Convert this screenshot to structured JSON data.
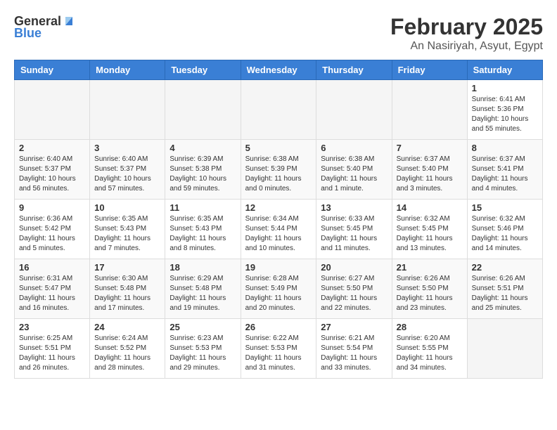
{
  "header": {
    "logo_general": "General",
    "logo_blue": "Blue",
    "month": "February 2025",
    "location": "An Nasiriyah, Asyut, Egypt"
  },
  "days_of_week": [
    "Sunday",
    "Monday",
    "Tuesday",
    "Wednesday",
    "Thursday",
    "Friday",
    "Saturday"
  ],
  "weeks": [
    [
      {
        "day": "",
        "info": ""
      },
      {
        "day": "",
        "info": ""
      },
      {
        "day": "",
        "info": ""
      },
      {
        "day": "",
        "info": ""
      },
      {
        "day": "",
        "info": ""
      },
      {
        "day": "",
        "info": ""
      },
      {
        "day": "1",
        "info": "Sunrise: 6:41 AM\nSunset: 5:36 PM\nDaylight: 10 hours and 55 minutes."
      }
    ],
    [
      {
        "day": "2",
        "info": "Sunrise: 6:40 AM\nSunset: 5:37 PM\nDaylight: 10 hours and 56 minutes."
      },
      {
        "day": "3",
        "info": "Sunrise: 6:40 AM\nSunset: 5:37 PM\nDaylight: 10 hours and 57 minutes."
      },
      {
        "day": "4",
        "info": "Sunrise: 6:39 AM\nSunset: 5:38 PM\nDaylight: 10 hours and 59 minutes."
      },
      {
        "day": "5",
        "info": "Sunrise: 6:38 AM\nSunset: 5:39 PM\nDaylight: 11 hours and 0 minutes."
      },
      {
        "day": "6",
        "info": "Sunrise: 6:38 AM\nSunset: 5:40 PM\nDaylight: 11 hours and 1 minute."
      },
      {
        "day": "7",
        "info": "Sunrise: 6:37 AM\nSunset: 5:40 PM\nDaylight: 11 hours and 3 minutes."
      },
      {
        "day": "8",
        "info": "Sunrise: 6:37 AM\nSunset: 5:41 PM\nDaylight: 11 hours and 4 minutes."
      }
    ],
    [
      {
        "day": "9",
        "info": "Sunrise: 6:36 AM\nSunset: 5:42 PM\nDaylight: 11 hours and 5 minutes."
      },
      {
        "day": "10",
        "info": "Sunrise: 6:35 AM\nSunset: 5:43 PM\nDaylight: 11 hours and 7 minutes."
      },
      {
        "day": "11",
        "info": "Sunrise: 6:35 AM\nSunset: 5:43 PM\nDaylight: 11 hours and 8 minutes."
      },
      {
        "day": "12",
        "info": "Sunrise: 6:34 AM\nSunset: 5:44 PM\nDaylight: 11 hours and 10 minutes."
      },
      {
        "day": "13",
        "info": "Sunrise: 6:33 AM\nSunset: 5:45 PM\nDaylight: 11 hours and 11 minutes."
      },
      {
        "day": "14",
        "info": "Sunrise: 6:32 AM\nSunset: 5:45 PM\nDaylight: 11 hours and 13 minutes."
      },
      {
        "day": "15",
        "info": "Sunrise: 6:32 AM\nSunset: 5:46 PM\nDaylight: 11 hours and 14 minutes."
      }
    ],
    [
      {
        "day": "16",
        "info": "Sunrise: 6:31 AM\nSunset: 5:47 PM\nDaylight: 11 hours and 16 minutes."
      },
      {
        "day": "17",
        "info": "Sunrise: 6:30 AM\nSunset: 5:48 PM\nDaylight: 11 hours and 17 minutes."
      },
      {
        "day": "18",
        "info": "Sunrise: 6:29 AM\nSunset: 5:48 PM\nDaylight: 11 hours and 19 minutes."
      },
      {
        "day": "19",
        "info": "Sunrise: 6:28 AM\nSunset: 5:49 PM\nDaylight: 11 hours and 20 minutes."
      },
      {
        "day": "20",
        "info": "Sunrise: 6:27 AM\nSunset: 5:50 PM\nDaylight: 11 hours and 22 minutes."
      },
      {
        "day": "21",
        "info": "Sunrise: 6:26 AM\nSunset: 5:50 PM\nDaylight: 11 hours and 23 minutes."
      },
      {
        "day": "22",
        "info": "Sunrise: 6:26 AM\nSunset: 5:51 PM\nDaylight: 11 hours and 25 minutes."
      }
    ],
    [
      {
        "day": "23",
        "info": "Sunrise: 6:25 AM\nSunset: 5:51 PM\nDaylight: 11 hours and 26 minutes."
      },
      {
        "day": "24",
        "info": "Sunrise: 6:24 AM\nSunset: 5:52 PM\nDaylight: 11 hours and 28 minutes."
      },
      {
        "day": "25",
        "info": "Sunrise: 6:23 AM\nSunset: 5:53 PM\nDaylight: 11 hours and 29 minutes."
      },
      {
        "day": "26",
        "info": "Sunrise: 6:22 AM\nSunset: 5:53 PM\nDaylight: 11 hours and 31 minutes."
      },
      {
        "day": "27",
        "info": "Sunrise: 6:21 AM\nSunset: 5:54 PM\nDaylight: 11 hours and 33 minutes."
      },
      {
        "day": "28",
        "info": "Sunrise: 6:20 AM\nSunset: 5:55 PM\nDaylight: 11 hours and 34 minutes."
      },
      {
        "day": "",
        "info": ""
      }
    ]
  ]
}
